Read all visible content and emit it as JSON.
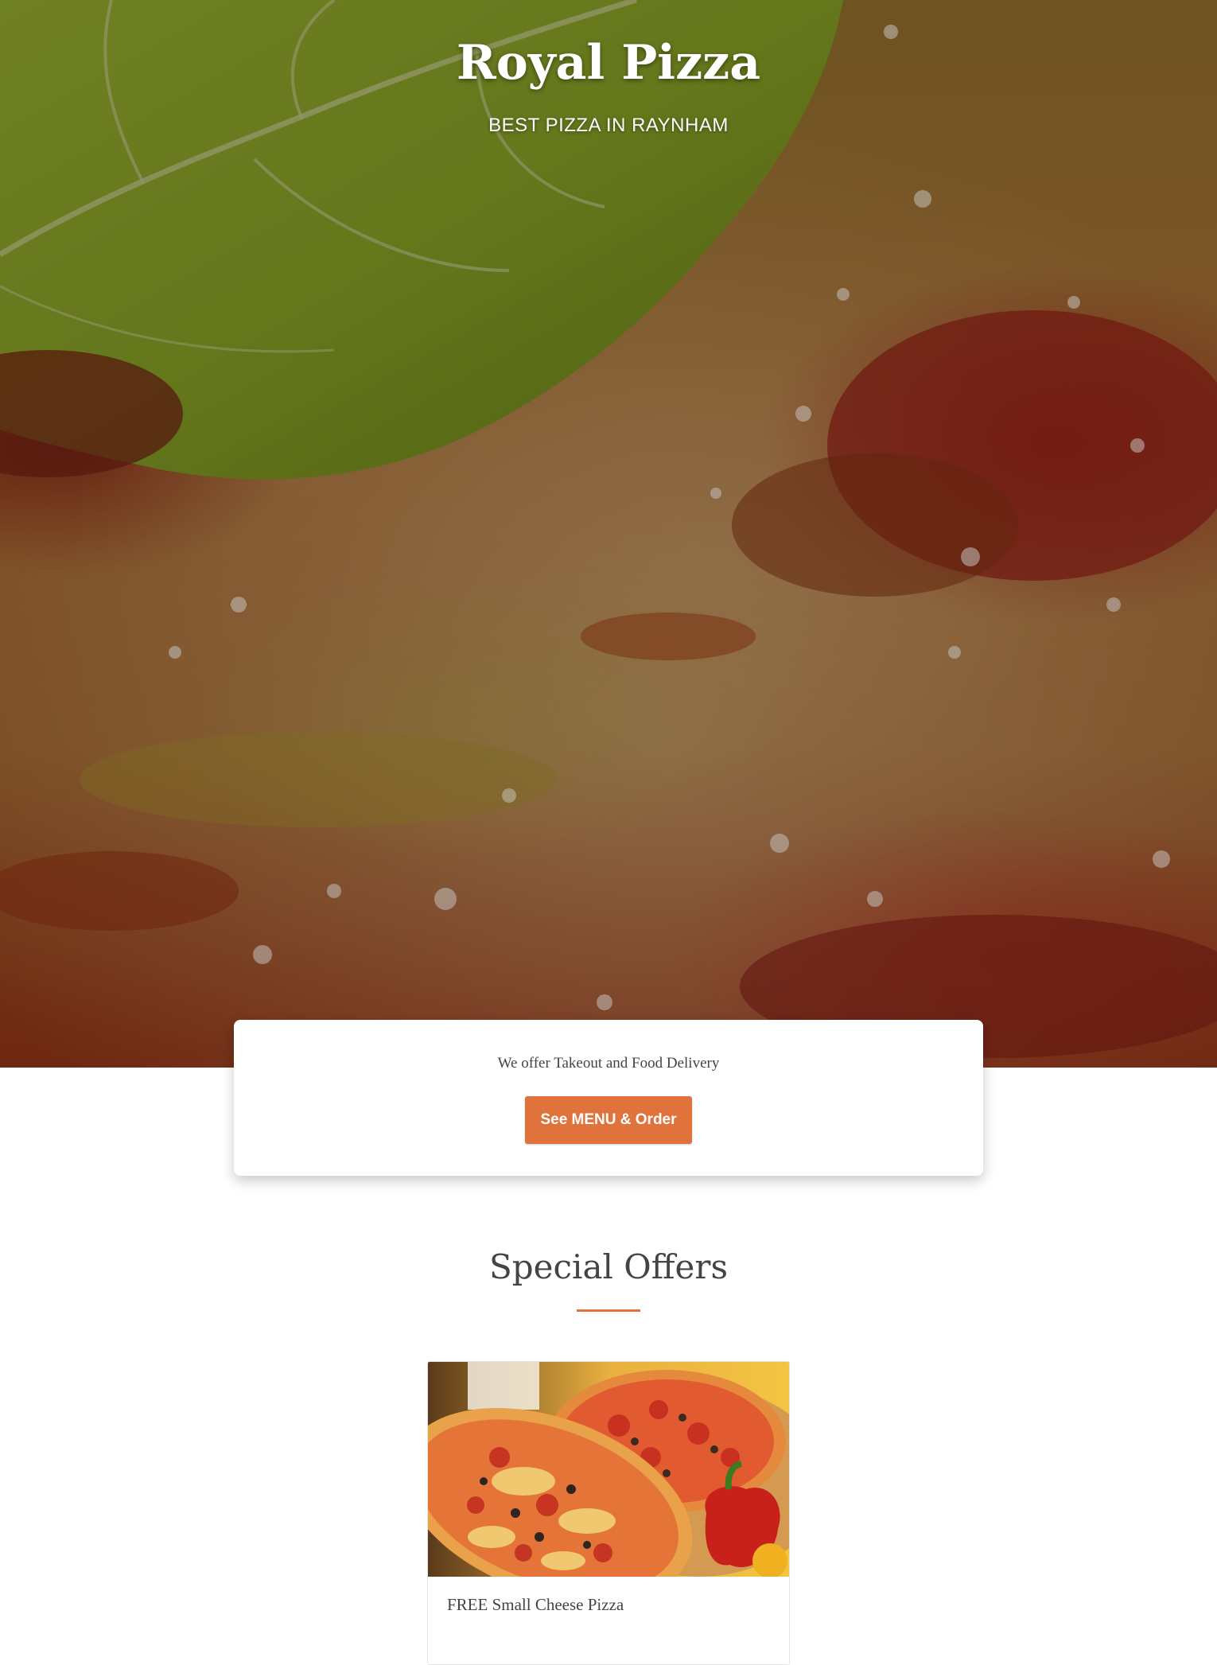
{
  "hero": {
    "title": "Royal Pizza",
    "subtitle": "BEST PIZZA IN RAYNHAM"
  },
  "order": {
    "text": "We offer Takeout and Food Delivery",
    "button_label": "See MENU & Order"
  },
  "special_offers": {
    "title": "Special Offers",
    "offers": [
      {
        "title": "FREE Small Cheese Pizza"
      }
    ]
  },
  "colors": {
    "accent": "#e0733c",
    "text": "#444444",
    "background": "#ffffff"
  }
}
